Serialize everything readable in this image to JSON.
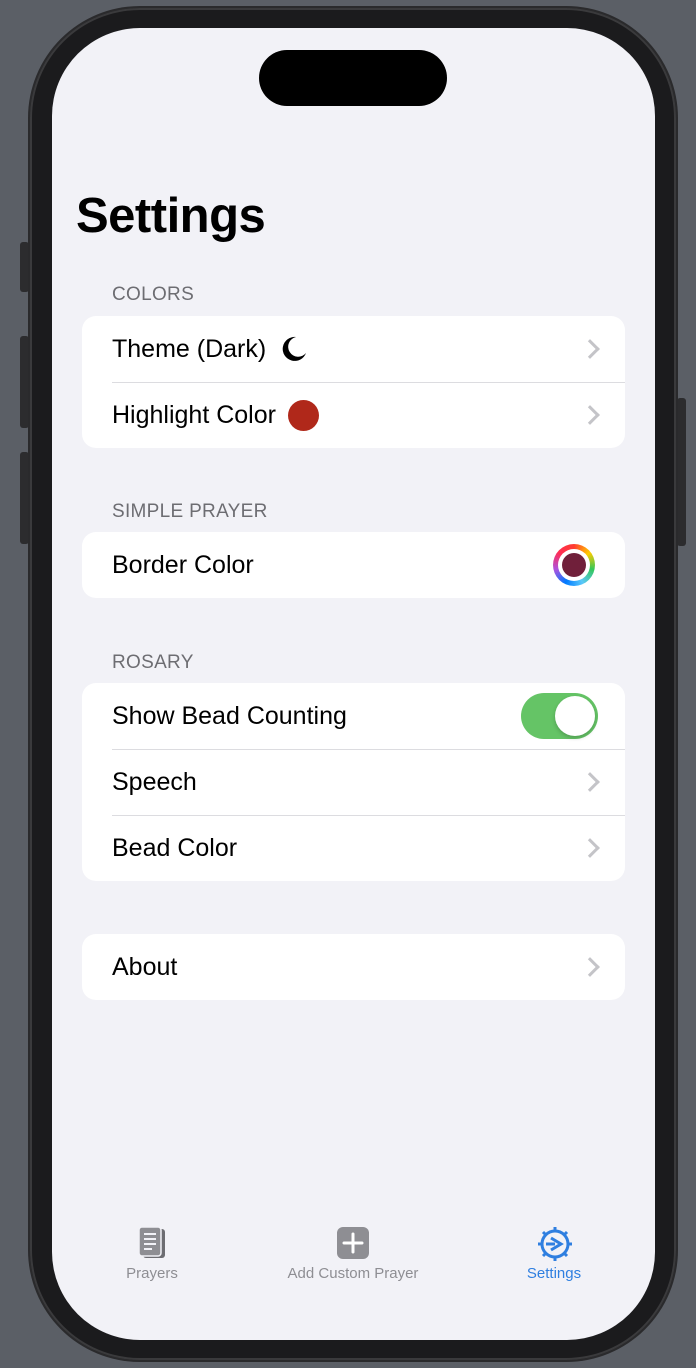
{
  "page": {
    "title": "Settings"
  },
  "sections": {
    "colors": {
      "header": "COLORS",
      "theme_label": "Theme (Dark)",
      "highlight_label": "Highlight Color",
      "highlight_color": "#b0281a"
    },
    "simple_prayer": {
      "header": "SIMPLE PRAYER",
      "border_label": "Border Color",
      "border_color": "#701f3a"
    },
    "rosary": {
      "header": "ROSARY",
      "bead_counting_label": "Show Bead Counting",
      "bead_counting_on": true,
      "speech_label": "Speech",
      "bead_color_label": "Bead Color"
    },
    "about": {
      "label": "About"
    }
  },
  "tabbar": {
    "items": [
      {
        "label": "Prayers",
        "icon": "document-icon",
        "active": false
      },
      {
        "label": "Add Custom Prayer",
        "icon": "plus-square-icon",
        "active": false
      },
      {
        "label": "Settings",
        "icon": "gear-icon",
        "active": true
      }
    ],
    "active_color": "#2f7fe0",
    "inactive_color": "#8e8e93"
  }
}
